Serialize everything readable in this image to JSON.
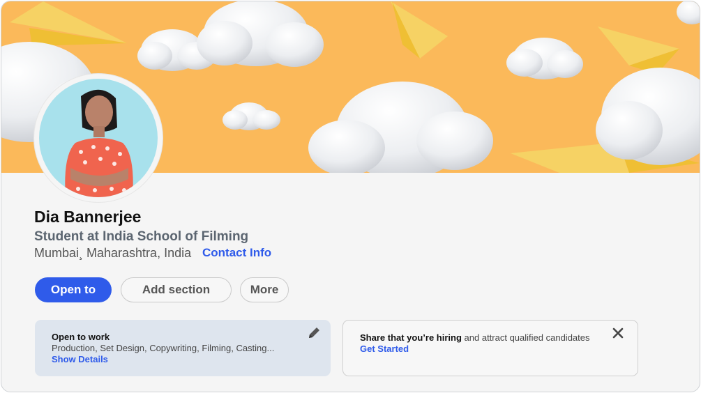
{
  "profile": {
    "name": "Dia Bannerjee",
    "headline": "Student at India School of Filming",
    "location": "Mumbai¸ Maharashtra, India",
    "contact_link": "Contact Info"
  },
  "actions": {
    "open_to": "Open to",
    "add_section": "Add section",
    "more": "More"
  },
  "open_to_work": {
    "title": "Open to work",
    "roles": "Production, Set Design, Copywriting, Filming, Casting...",
    "link": "Show Details",
    "icon": "pencil-icon"
  },
  "hiring": {
    "title_bold": "Share that you’re hiring",
    "title_rest": " and attract qualified candidates",
    "link": "Get Started",
    "icon": "close-icon"
  },
  "colors": {
    "banner": "#fbb95a",
    "accent": "#2f5bea",
    "open_to_work_bg": "#dee5ee",
    "card_bg": "#f5f5f5"
  }
}
